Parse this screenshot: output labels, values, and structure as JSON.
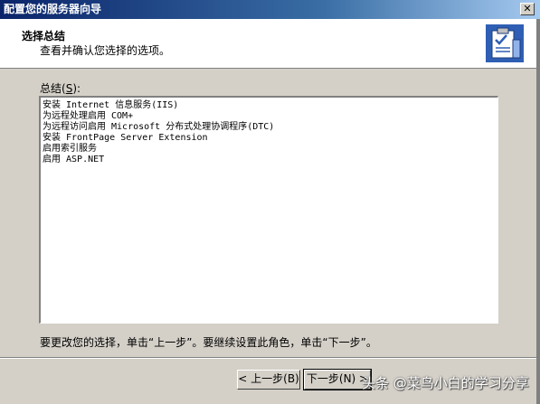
{
  "window": {
    "title": "配置您的服务器向导",
    "close_glyph": "✕"
  },
  "header": {
    "title": "选择总结",
    "subtitle": "查看并确认您选择的选项。",
    "icon": "wizard-clipboard-icon"
  },
  "summary": {
    "label_prefix": "总结(",
    "label_mnemonic": "S",
    "label_suffix": "):",
    "lines": [
      "安装 Internet 信息服务(IIS)",
      "为远程处理启用 COM+",
      "为远程访问启用 Microsoft 分布式处理协调程序(DTC)",
      "安装 FrontPage Server Extension",
      "启用索引服务",
      "启用 ASP.NET"
    ]
  },
  "footer": {
    "instruction": "要更改您的选择，单击“上一步”。要继续设置此角色，单击“下一步”。"
  },
  "buttons": {
    "back": "< 上一步(B)",
    "next": "下一步(N) >"
  },
  "watermark": "头条 @菜鸟小白的学习分享"
}
